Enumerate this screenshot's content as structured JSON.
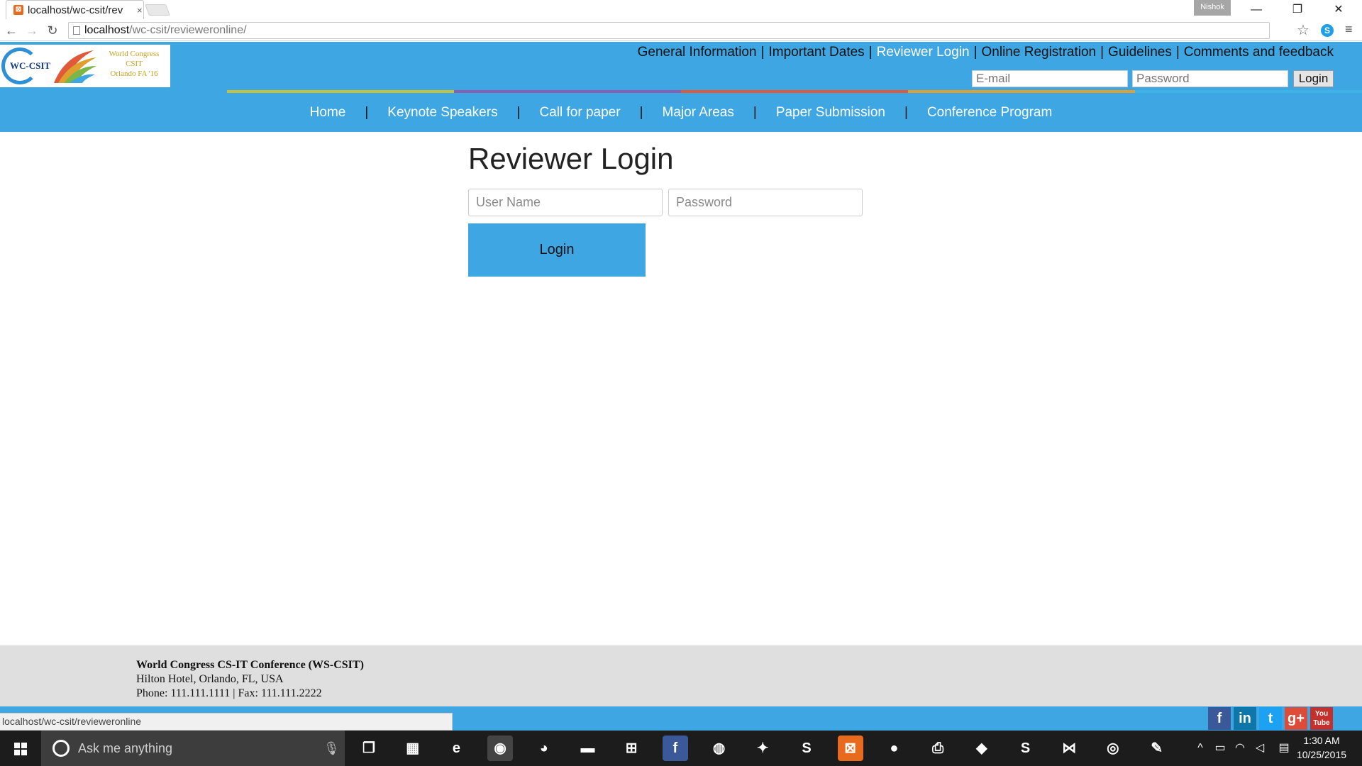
{
  "browser": {
    "tab_title": "localhost/wc-csit/rev",
    "tab_close": "×",
    "profile_name": "Nishok",
    "url_host": "localhost",
    "url_path": "/wc-csit/revieweronline/",
    "minimize": "—",
    "restore": "❐",
    "close": "✕",
    "back": "←",
    "forward": "→",
    "reload": "↻",
    "star": "☆",
    "menu": "≡",
    "skype_ext": "S"
  },
  "site": {
    "logo": {
      "acronym": "WC-CSIT",
      "line1": "World Congress",
      "line2": "CSIT",
      "line3": "Orlando FA '16"
    },
    "top_nav": [
      {
        "label": "General Information"
      },
      {
        "label": "Important Dates"
      },
      {
        "label": "Reviewer Login",
        "active": true
      },
      {
        "label": "Online Registration"
      },
      {
        "label": "Guidelines"
      },
      {
        "label": "Comments and feedback"
      }
    ],
    "top_nav_separator": "|",
    "header_login": {
      "email_placeholder": "E-mail",
      "password_placeholder": "Password",
      "button": "Login"
    },
    "main_nav": [
      {
        "label": "Home"
      },
      {
        "label": "Keynote Speakers"
      },
      {
        "label": "Call for paper"
      },
      {
        "label": "Major Areas"
      },
      {
        "label": "Paper Submission"
      },
      {
        "label": "Conference Program"
      }
    ],
    "main_nav_separator": "|",
    "rainbow_colors": [
      "#3da6e3",
      "#c7c13a",
      "#8a5fb0",
      "#e05a3a",
      "#e0a030",
      "#3db3e6",
      "#7ab648"
    ]
  },
  "main": {
    "title": "Reviewer Login",
    "username_placeholder": "User Name",
    "password_placeholder": "Password",
    "login_button": "Login"
  },
  "footer": {
    "org": "World Congress CS-IT Conference (WS-CSIT)",
    "address": "Hilton Hotel, Orlando, FL, USA",
    "contact": "Phone: 111.111.1111 | Fax: 111.111.2222",
    "social": [
      {
        "name": "facebook-icon",
        "glyph": "f",
        "color": "#3b5998"
      },
      {
        "name": "linkedin-icon",
        "glyph": "in",
        "color": "#0e76a8"
      },
      {
        "name": "twitter-icon",
        "glyph": "t",
        "color": "#1da1f2"
      },
      {
        "name": "googleplus-icon",
        "glyph": "g+",
        "color": "#dd4b39"
      },
      {
        "name": "youtube-icon",
        "glyph": "You Tube",
        "color": "#c4302b"
      }
    ]
  },
  "status_bar": {
    "url": "localhost/wc-csit/revieweronline"
  },
  "taskbar": {
    "search_placeholder": "Ask me anything",
    "time": "1:30 AM",
    "date": "10/25/2015",
    "apps": [
      {
        "name": "task-view-icon",
        "glyph": "❐",
        "color": "#1c1c1c"
      },
      {
        "name": "store-grid-icon",
        "glyph": "▦",
        "color": "#1c1c1c"
      },
      {
        "name": "edge-icon",
        "glyph": "e",
        "color": "#1c1c1c"
      },
      {
        "name": "chrome-icon",
        "glyph": "◉",
        "color": "#444"
      },
      {
        "name": "firefox-icon",
        "glyph": "◕",
        "color": "#1c1c1c"
      },
      {
        "name": "file-explorer-icon",
        "glyph": "▬",
        "color": "#1c1c1c"
      },
      {
        "name": "windows-store-icon",
        "glyph": "⊞",
        "color": "#1c1c1c"
      },
      {
        "name": "facebook-app-icon",
        "glyph": "f",
        "color": "#3b5998"
      },
      {
        "name": "eclipse-icon",
        "glyph": "◍",
        "color": "#1c1c1c"
      },
      {
        "name": "android-studio-icon",
        "glyph": "✦",
        "color": "#1c1c1c"
      },
      {
        "name": "sublime-text-icon",
        "glyph": "S",
        "color": "#1c1c1c"
      },
      {
        "name": "xampp-icon",
        "glyph": "⊠",
        "color": "#e86a1c"
      },
      {
        "name": "github-icon",
        "glyph": "●",
        "color": "#1c1c1c"
      },
      {
        "name": "printer-icon",
        "glyph": "⎙",
        "color": "#1c1c1c"
      },
      {
        "name": "feedly-icon",
        "glyph": "◆",
        "color": "#1c1c1c"
      },
      {
        "name": "skype-icon",
        "glyph": "S",
        "color": "#1c1c1c"
      },
      {
        "name": "visual-studio-icon",
        "glyph": "⋈",
        "color": "#1c1c1c"
      },
      {
        "name": "browser-globe-icon",
        "glyph": "◎",
        "color": "#1c1c1c"
      },
      {
        "name": "paint-icon",
        "glyph": "✎",
        "color": "#1c1c1c"
      }
    ]
  }
}
